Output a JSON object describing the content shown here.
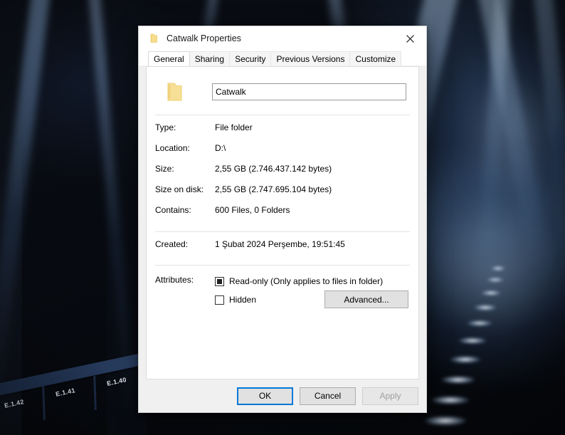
{
  "window": {
    "title": "Catwalk Properties",
    "icon": "folder-icon",
    "close_label": "×"
  },
  "tabs": [
    {
      "label": "General",
      "active": true
    },
    {
      "label": "Sharing",
      "active": false
    },
    {
      "label": "Security",
      "active": false
    },
    {
      "label": "Previous Versions",
      "active": false
    },
    {
      "label": "Customize",
      "active": false
    }
  ],
  "general": {
    "folder_icon": "folder-icon",
    "name_value": "Catwalk",
    "name_placeholder": "",
    "fields": [
      {
        "label": "Type:",
        "value": "File folder"
      },
      {
        "label": "Location:",
        "value": "D:\\"
      },
      {
        "label": "Size:",
        "value": "2,55 GB (2.746.437.142 bytes)"
      },
      {
        "label": "Size on disk:",
        "value": "2,55 GB (2.747.695.104 bytes)"
      },
      {
        "label": "Contains:",
        "value": "600 Files, 0 Folders"
      }
    ],
    "created": {
      "label": "Created:",
      "value": "1 Şubat 2024 Perşembe, 19:51:45"
    },
    "attributes": {
      "label": "Attributes:",
      "readonly": {
        "label": "Read-only (Only applies to files in folder)",
        "state": "indeterminate"
      },
      "hidden": {
        "label": "Hidden",
        "state": "unchecked"
      },
      "advanced_label": "Advanced..."
    }
  },
  "footer": {
    "ok_label": "OK",
    "cancel_label": "Cancel",
    "apply_label": "Apply",
    "apply_enabled": false
  },
  "background": {
    "description": "dark stage with blue light beams",
    "rail_labels": [
      "E.1.42",
      "E.1.41",
      "E.1.40"
    ]
  },
  "colors": {
    "accent": "#0078d7",
    "dialog_bg": "#f0f0f0",
    "panel_bg": "#ffffff",
    "folder_yellow": "#f2d16b"
  }
}
